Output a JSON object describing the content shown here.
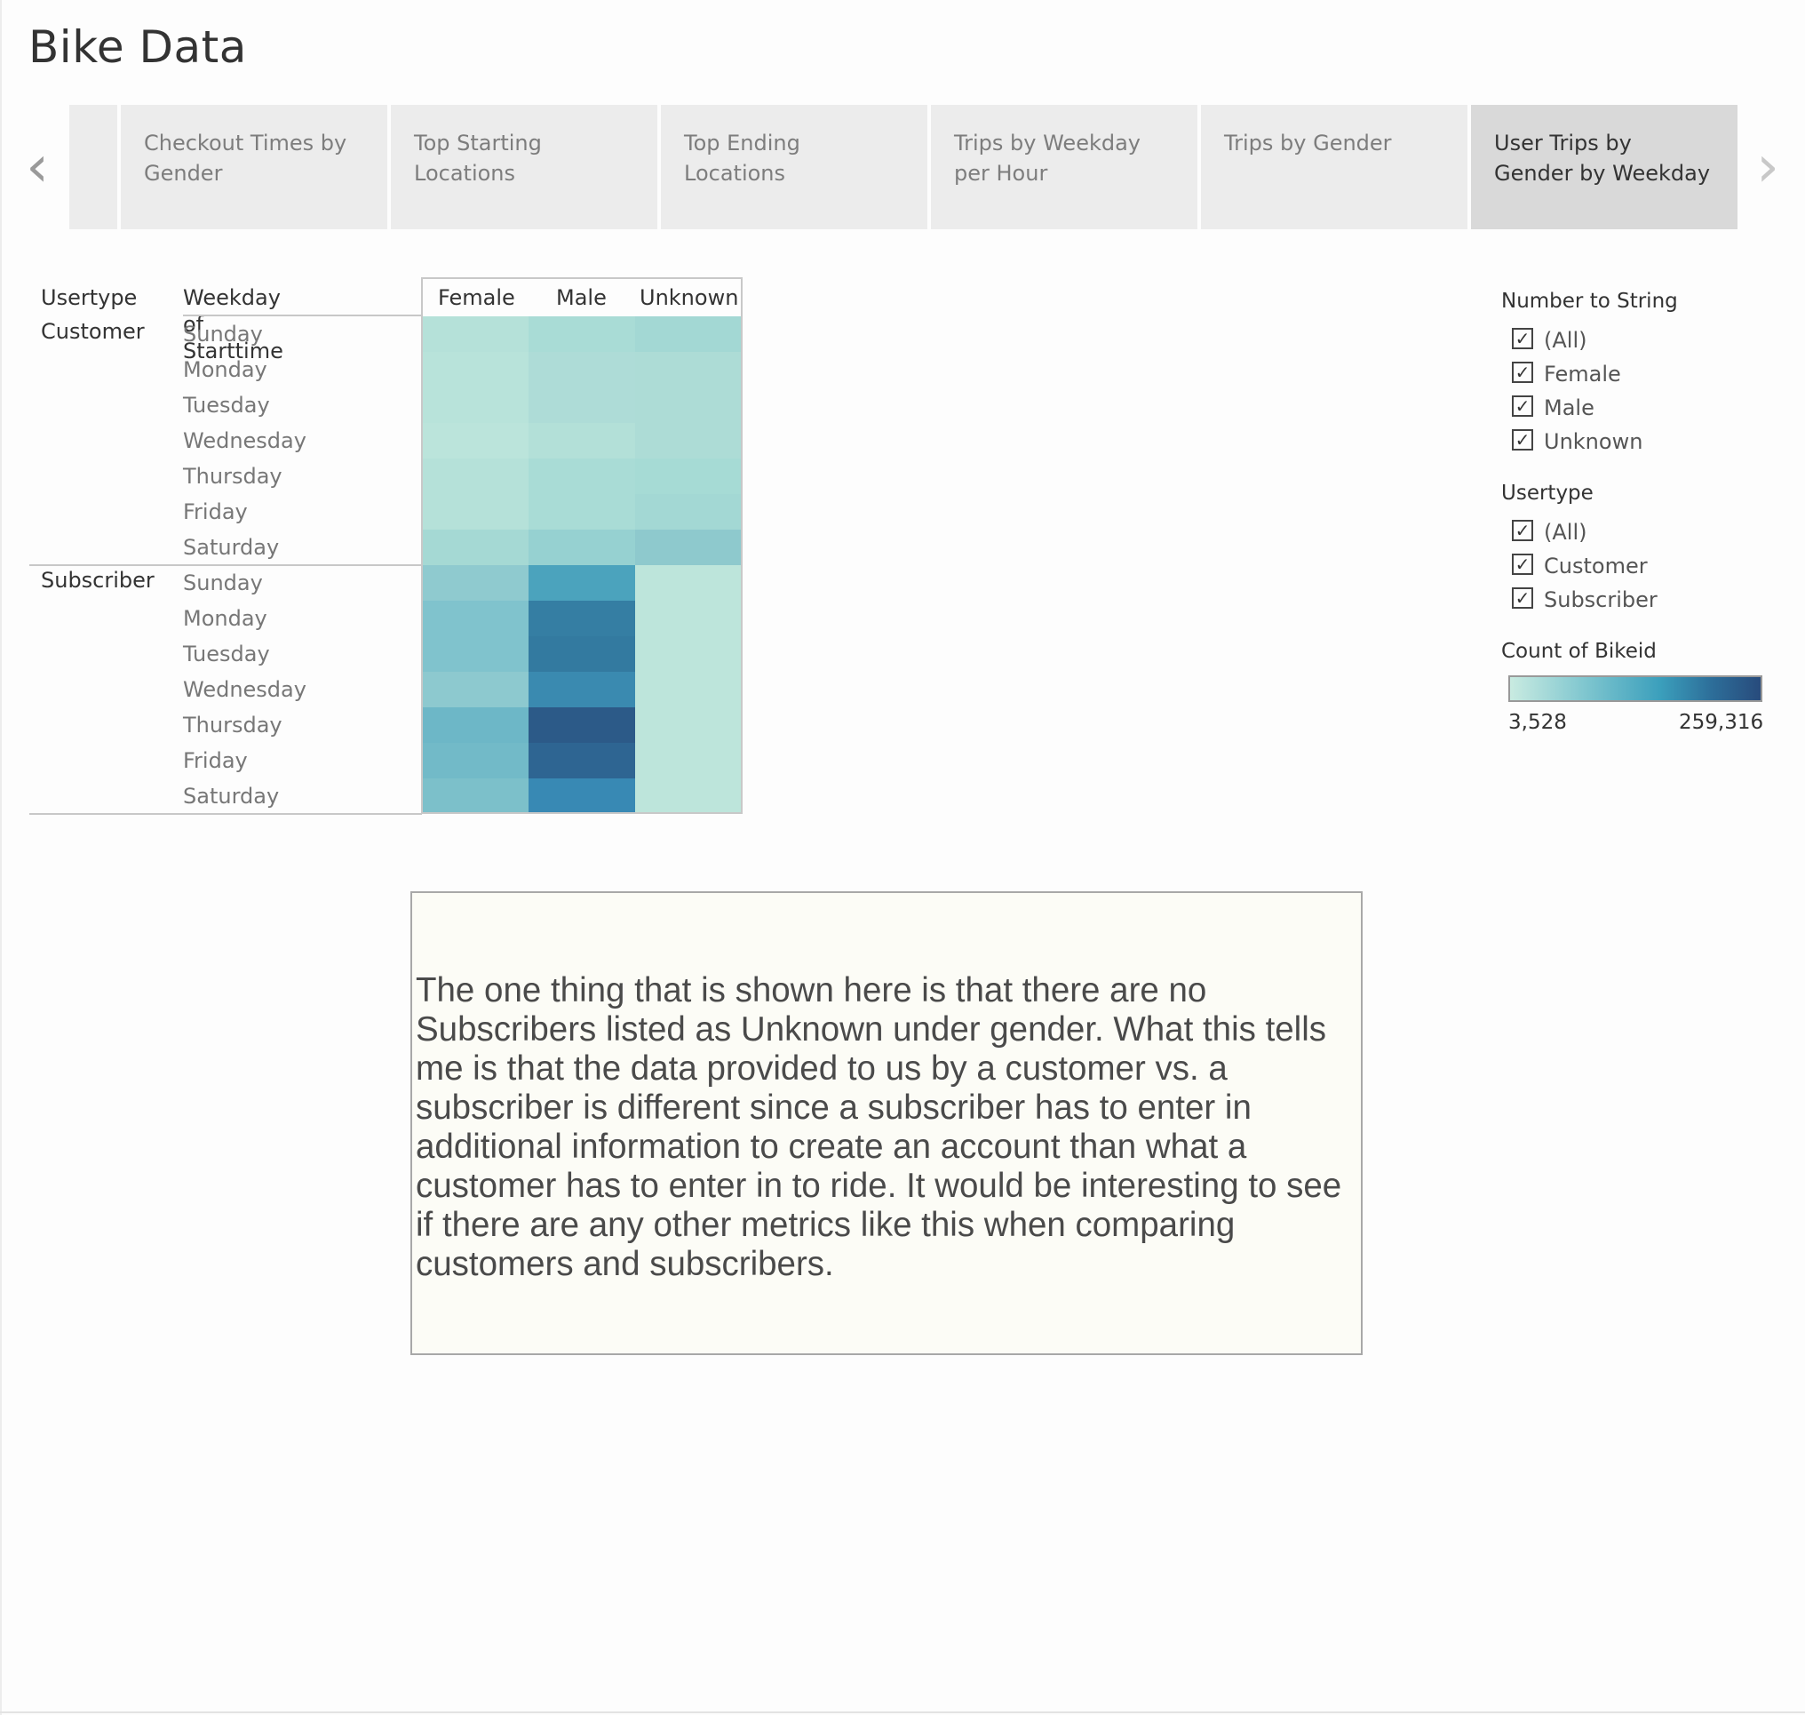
{
  "title": "Bike Data",
  "tabs": [
    {
      "label": "Checkout Times by Gender",
      "active": false
    },
    {
      "label": "Top Starting Locations",
      "active": false
    },
    {
      "label": "Top Ending Locations",
      "active": false
    },
    {
      "label": "Trips by Weekday per Hour",
      "active": false
    },
    {
      "label": "Trips by Gender",
      "active": false
    },
    {
      "label": "User Trips by Gender by Weekday",
      "active": true
    }
  ],
  "nav": {
    "prev_icon": "‹",
    "next_icon": "›"
  },
  "table": {
    "headers": {
      "usertype": "Usertype",
      "weekday": "Weekday of Starttime",
      "genders": [
        "Female",
        "Male",
        "Unknown"
      ]
    },
    "groups": [
      {
        "name": "Customer",
        "days": [
          "Sunday",
          "Monday",
          "Tuesday",
          "Wednesday",
          "Thursday",
          "Friday",
          "Saturday"
        ],
        "colors": [
          [
            "#b5e1d9",
            "#a9dcd6",
            "#a3d8d4"
          ],
          [
            "#b8e3da",
            "#aedcd7",
            "#addcd6"
          ],
          [
            "#b8e3da",
            "#aedcd7",
            "#addcd6"
          ],
          [
            "#bbe4db",
            "#b3e0d8",
            "#addcd6"
          ],
          [
            "#b5e1d9",
            "#a9dcd6",
            "#a6dbd5"
          ],
          [
            "#b5e1d9",
            "#a9dcd6",
            "#a3d8d4"
          ],
          [
            "#a5d9d4",
            "#96d1d1",
            "#8ec9cd"
          ]
        ]
      },
      {
        "name": "Subscriber",
        "days": [
          "Sunday",
          "Monday",
          "Tuesday",
          "Wednesday",
          "Thursday",
          "Friday",
          "Saturday"
        ],
        "colors": [
          [
            "#8fcacf",
            "#4ba3bd",
            "#bde5db"
          ],
          [
            "#80c3cd",
            "#357ea3",
            "#bde5db"
          ],
          [
            "#80c3cd",
            "#337aa0",
            "#bde5db"
          ],
          [
            "#8dc9cf",
            "#3a8ab0",
            "#bde5db"
          ],
          [
            "#6db7c7",
            "#2c5a88",
            "#bde5db"
          ],
          [
            "#72bac8",
            "#2e6592",
            "#bde5db"
          ],
          [
            "#7cc0ca",
            "#3889b4",
            "#bde5db"
          ]
        ]
      }
    ]
  },
  "filters": {
    "number_to_string": {
      "title": "Number to String",
      "items": [
        "(All)",
        "Female",
        "Male",
        "Unknown"
      ]
    },
    "usertype": {
      "title": "Usertype",
      "items": [
        "(All)",
        "Customer",
        "Subscriber"
      ]
    },
    "check_icon": "✓"
  },
  "legend": {
    "title": "Count of Bikeid",
    "min": "3,528",
    "max": "259,316"
  },
  "note": "The one thing that is shown here is that there are no Subscribers listed as Unknown under gender. What this tells me is that the data provided to us by a customer vs. a subscriber is different since a subscriber has to enter in additional information to create an account than what a customer has to enter in to ride. It would be interesting to see if there are any other metrics like this when comparing customers and subscribers."
}
